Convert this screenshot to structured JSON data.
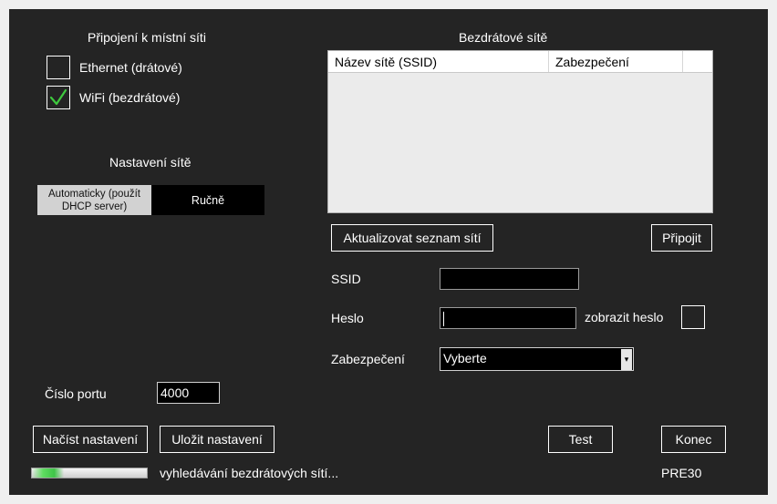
{
  "local_network": {
    "title": "Připojení k místní síti",
    "ethernet": {
      "label": "Ethernet (drátové)",
      "checked": false
    },
    "wifi": {
      "label": "WiFi (bezdrátové)",
      "checked": true
    }
  },
  "network_settings": {
    "title": "Nastavení sítě",
    "auto_label": "Automaticky (použít DHCP server)",
    "manual_label": "Ručně"
  },
  "wireless": {
    "title": "Bezdrátové sítě",
    "columns": [
      "Název sítě (SSID)",
      "Zabezpečení"
    ],
    "refresh_button": "Aktualizovat seznam sítí",
    "connect_button": "Připojit",
    "ssid_label": "SSID",
    "ssid_value": "",
    "password_label": "Heslo",
    "password_value": "",
    "show_password_label": "zobrazit heslo",
    "security_label": "Zabezpečení",
    "security_selected": "Vyberte"
  },
  "port": {
    "label": "Číslo portu",
    "value": "4000"
  },
  "buttons": {
    "load": "Načíst nastavení",
    "save": "Uložit nastavení",
    "test": "Test",
    "exit": "Konec"
  },
  "status": {
    "text": "vyhledávání bezdrátových sítí...",
    "device": "PRE30",
    "progress": 0.28
  },
  "colors": {
    "background": "#242424",
    "check_accent": "#3ec93e",
    "selected_mode": "#d2d2d2",
    "list_background": "#ebebeb"
  }
}
